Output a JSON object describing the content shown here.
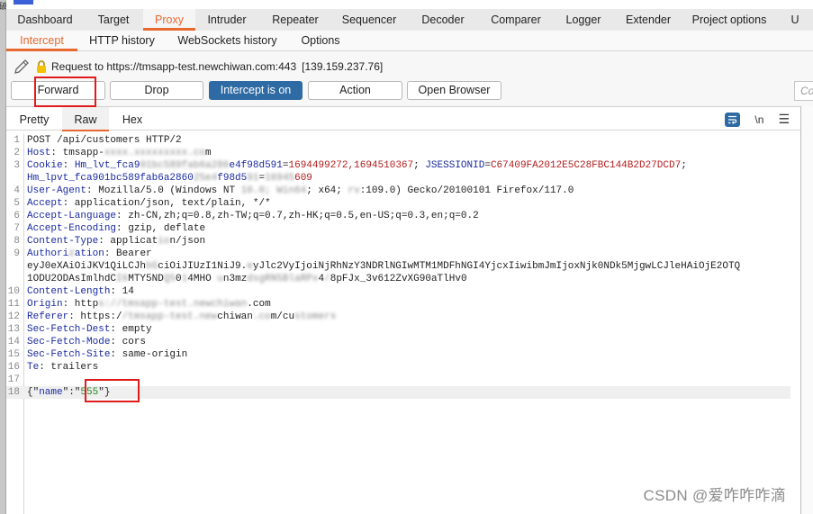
{
  "main_tabs": [
    {
      "label": "Dashboard",
      "active": false
    },
    {
      "label": "Target",
      "active": false
    },
    {
      "label": "Proxy",
      "active": true
    },
    {
      "label": "Intruder",
      "active": false
    },
    {
      "label": "Repeater",
      "active": false
    },
    {
      "label": "Sequencer",
      "active": false
    },
    {
      "label": "Decoder",
      "active": false
    },
    {
      "label": "Comparer",
      "active": false
    },
    {
      "label": "Logger",
      "active": false
    },
    {
      "label": "Extender",
      "active": false
    },
    {
      "label": "Project options",
      "active": false
    },
    {
      "label": "U",
      "active": false
    }
  ],
  "sub_tabs": [
    {
      "label": "Intercept",
      "active": true
    },
    {
      "label": "HTTP history",
      "active": false
    },
    {
      "label": "WebSockets history",
      "active": false
    },
    {
      "label": "Options",
      "active": false
    }
  ],
  "request_info": {
    "text": "Request to https://tmsapp-test.newchiwan.com:443",
    "ip": "[139.159.237.76]"
  },
  "buttons": {
    "forward": "Forward",
    "drop": "Drop",
    "intercept": "Intercept is on",
    "action": "Action",
    "open_browser": "Open Browser"
  },
  "comment_placeholder": "Co",
  "view_tabs": [
    {
      "label": "Pretty",
      "active": false
    },
    {
      "label": "Raw",
      "active": true
    },
    {
      "label": "Hex",
      "active": false
    }
  ],
  "toolbar": {
    "newline_label": "\\n",
    "menu_label": "☰"
  },
  "request_lines": [
    {
      "n": "1",
      "parts": [
        [
          "v",
          "POST /api/customers HTTP/2"
        ]
      ]
    },
    {
      "n": "2",
      "parts": [
        [
          "k",
          "Host"
        ],
        [
          "v",
          ": tmsapp-"
        ],
        [
          "blur",
          "xxxx.xxxxxxxxx.co"
        ],
        [
          "v",
          "m"
        ]
      ]
    },
    {
      "n": "3",
      "parts": [
        [
          "k",
          "Cookie"
        ],
        [
          "v",
          ": "
        ],
        [
          "k",
          "Hm_lvt_fca9"
        ],
        [
          "blur",
          "01bc589fab6a286"
        ],
        [
          "k",
          "e4f98d591"
        ],
        [
          "v",
          "="
        ],
        [
          "r",
          "1694499272,1694510367"
        ],
        [
          "v",
          "; "
        ],
        [
          "k",
          "JSESSIONID"
        ],
        [
          "v",
          "="
        ],
        [
          "r",
          "C67409FA2012E5C28FBC144B2D27DCD7"
        ],
        [
          "v",
          ";"
        ]
      ]
    },
    {
      "n": "",
      "parts": [
        [
          "k",
          "Hm_lpvt_fca901bc589fab6a2860"
        ],
        [
          "blur",
          "25e4"
        ],
        [
          "k",
          "f98d5"
        ],
        [
          "blur",
          "91"
        ],
        [
          "v",
          "="
        ],
        [
          "blur",
          "16945"
        ],
        [
          "r",
          "609"
        ]
      ]
    },
    {
      "n": "4",
      "parts": [
        [
          "k",
          "User-Agent"
        ],
        [
          "v",
          ": Mozilla/5.0 (Windows NT "
        ],
        [
          "blur",
          "10.0; Win64"
        ],
        [
          "v",
          "; x64; "
        ],
        [
          "blur",
          "rv"
        ],
        [
          "v",
          ":109.0) Gecko/20100101 Firefox/117.0"
        ]
      ]
    },
    {
      "n": "5",
      "parts": [
        [
          "k",
          "Accept"
        ],
        [
          "v",
          ": application/json, text/plain, */*"
        ]
      ]
    },
    {
      "n": "6",
      "parts": [
        [
          "k",
          "Accept-Language"
        ],
        [
          "v",
          ": zh-CN,zh;q=0.8,zh-TW;q=0.7,zh-HK;q=0.5,en-US;q=0.3,en;q=0.2"
        ]
      ]
    },
    {
      "n": "7",
      "parts": [
        [
          "k",
          "Accept-Encoding"
        ],
        [
          "v",
          ": gzip, deflate"
        ]
      ]
    },
    {
      "n": "8",
      "parts": [
        [
          "k",
          "Content-Type"
        ],
        [
          "v",
          ": applicat"
        ],
        [
          "blur",
          "io"
        ],
        [
          "v",
          "n/json"
        ]
      ]
    },
    {
      "n": "9",
      "parts": [
        [
          "k",
          "Authori"
        ],
        [
          "blur",
          "z"
        ],
        [
          "k",
          "ation"
        ],
        [
          "v",
          ": Bearer"
        ]
      ]
    },
    {
      "n": "",
      "parts": [
        [
          "v",
          "eyJ0eXAiOiJKV1QiLCJh"
        ],
        [
          "blur",
          "bG"
        ],
        [
          "v",
          "ciOiJIUzI1NiJ9."
        ],
        [
          "blur",
          "e"
        ],
        [
          "v",
          "yJlc2VyIjoiNjRhNzY3NDRlNGIwMTM1MDFhNGI4YjcxIiwibmJmIjoxNjk0NDk5MjgwLCJleHAiOjE2OTQ"
        ]
      ]
    },
    {
      "n": "",
      "parts": [
        [
          "v",
          "1ODU2ODAsImlhdC"
        ],
        [
          "blur",
          "I6"
        ],
        [
          "v",
          "MTY5ND"
        ],
        [
          "blur",
          "Q5"
        ],
        [
          "v",
          "0"
        ],
        [
          "blur",
          "1"
        ],
        [
          "v",
          "4MHO "
        ],
        [
          "blur",
          "u"
        ],
        [
          "v",
          "n3mz"
        ],
        [
          "blur",
          "dsgRN5BlaRPx"
        ],
        [
          "v",
          "4"
        ],
        [
          "blur",
          "/"
        ],
        [
          "v",
          "8pFJx_3v612ZvXG90aTlHv0"
        ]
      ]
    },
    {
      "n": "10",
      "parts": [
        [
          "k",
          "Content-Length"
        ],
        [
          "v",
          ": 14"
        ]
      ]
    },
    {
      "n": "11",
      "parts": [
        [
          "k",
          "Origin"
        ],
        [
          "v",
          ": http"
        ],
        [
          "blur",
          "s://tmsapp-tes"
        ],
        [
          "blur",
          "t.newchiwan"
        ],
        [
          "v",
          ".com"
        ]
      ]
    },
    {
      "n": "12",
      "parts": [
        [
          "k",
          "Referer"
        ],
        [
          "v",
          ": https:/"
        ],
        [
          "blur",
          "/tmsapp-test.new"
        ],
        [
          "v",
          "chiwan"
        ],
        [
          "blur",
          ".co"
        ],
        [
          "v",
          "m/cu"
        ],
        [
          "blur",
          "stomers"
        ]
      ]
    },
    {
      "n": "13",
      "parts": [
        [
          "k",
          "Sec-Fetch-Dest"
        ],
        [
          "v",
          ": empty"
        ]
      ]
    },
    {
      "n": "14",
      "parts": [
        [
          "k",
          "Sec-Fetch-Mode"
        ],
        [
          "v",
          ": cors"
        ]
      ]
    },
    {
      "n": "15",
      "parts": [
        [
          "k",
          "Sec-Fetch-Site"
        ],
        [
          "v",
          ": same-origin"
        ]
      ]
    },
    {
      "n": "16",
      "parts": [
        [
          "k",
          "Te"
        ],
        [
          "v",
          ": trailers"
        ]
      ]
    },
    {
      "n": "17",
      "parts": []
    },
    {
      "n": "18",
      "hl": true,
      "parts": [
        [
          "v",
          "{\""
        ],
        [
          "k",
          "name"
        ],
        [
          "v",
          "\":\""
        ],
        [
          "g",
          "555"
        ],
        [
          "v",
          "\"}"
        ]
      ]
    }
  ],
  "watermark": "CSDN @爱咋咋咋滴"
}
